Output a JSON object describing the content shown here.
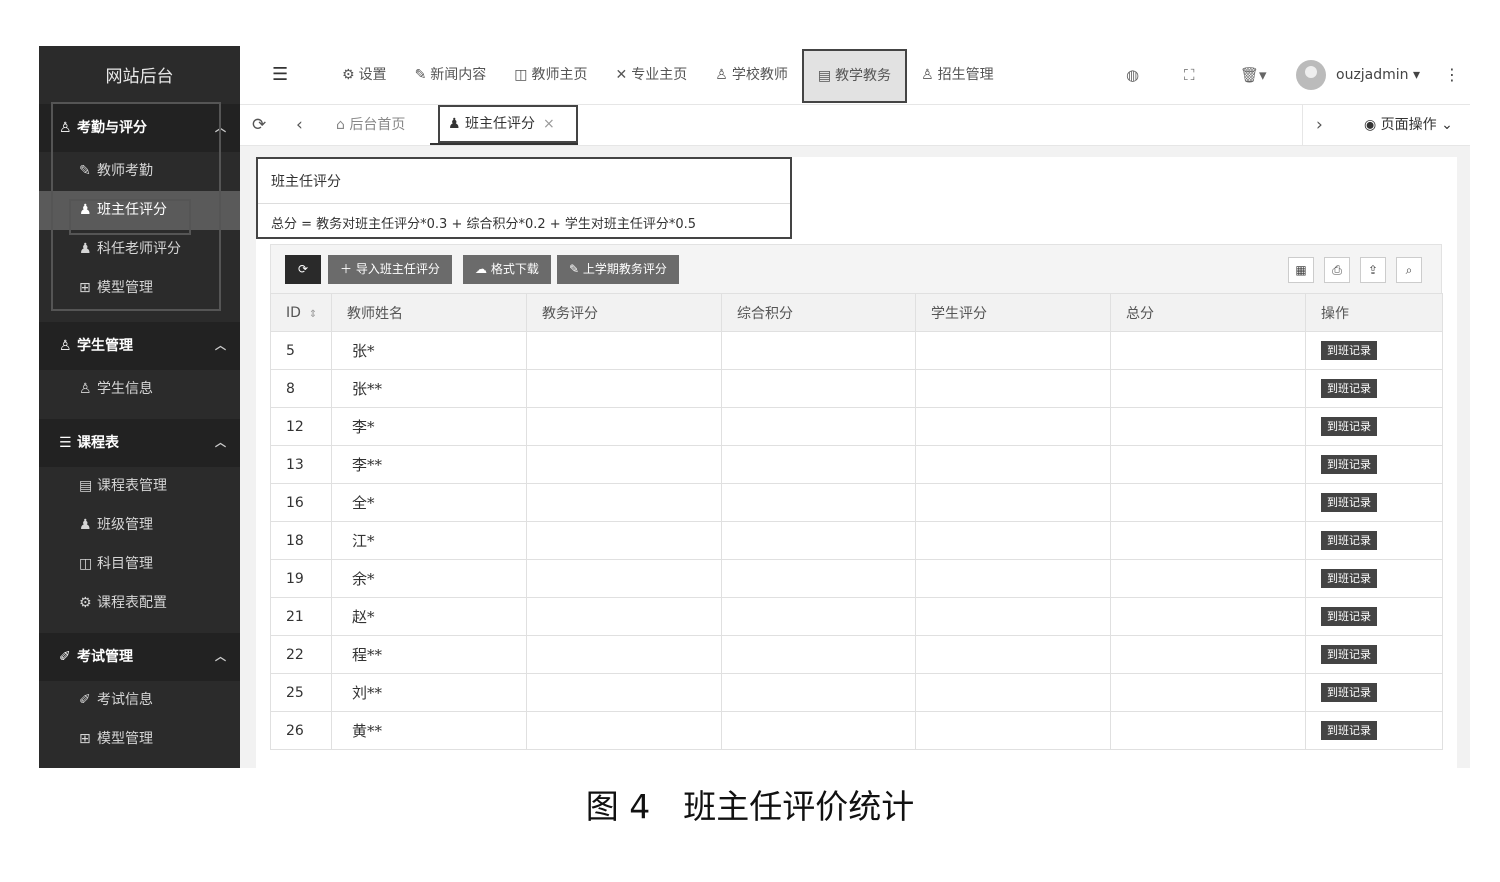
{
  "sidebar": {
    "logo": "网站后台",
    "groups": [
      {
        "label": "考勤与评分",
        "icon": "user-icon",
        "items": [
          {
            "label": "教师考勤",
            "icon": "edit-icon"
          },
          {
            "label": "班主任评分",
            "icon": "user-solid-icon"
          },
          {
            "label": "科任老师评分",
            "icon": "user-solid-icon"
          },
          {
            "label": "模型管理",
            "icon": "hierarchy-icon"
          }
        ]
      },
      {
        "label": "学生管理",
        "icon": "user-icon",
        "items": [
          {
            "label": "学生信息",
            "icon": "users-icon"
          }
        ]
      },
      {
        "label": "课程表",
        "icon": "list-icon",
        "items": [
          {
            "label": "课程表管理",
            "icon": "table-icon"
          },
          {
            "label": "班级管理",
            "icon": "user-solid-icon"
          },
          {
            "label": "科目管理",
            "icon": "book-icon"
          },
          {
            "label": "课程表配置",
            "icon": "gear-icon"
          }
        ]
      },
      {
        "label": "考试管理",
        "icon": "pen-icon",
        "items": [
          {
            "label": "考试信息",
            "icon": "pen-icon"
          },
          {
            "label": "模型管理",
            "icon": "hierarchy-icon"
          }
        ]
      }
    ]
  },
  "header": {
    "nav": [
      {
        "label": "设置",
        "icon": "gear-icon"
      },
      {
        "label": "新闻内容",
        "icon": "edit-icon"
      },
      {
        "label": "教师主页",
        "icon": "book-icon"
      },
      {
        "label": "专业主页",
        "icon": "tools-icon"
      },
      {
        "label": "学校教师",
        "icon": "user-icon"
      },
      {
        "label": "教学教务",
        "icon": "document-icon"
      },
      {
        "label": "招生管理",
        "icon": "users-icon"
      }
    ],
    "username": "ouzjadmin"
  },
  "tabs": {
    "home": "后台首页",
    "active": "班主任评分",
    "page_ops": "页面操作"
  },
  "card": {
    "title": "班主任评分",
    "formula": "总分 = 教务对班主任评分*0.3 + 综合积分*0.2 + 学生对班主任评分*0.5"
  },
  "toolbar": {
    "import_label": "导入班主任评分",
    "download_label": "格式下载",
    "last_term_label": "上学期教务评分"
  },
  "table": {
    "columns": [
      "ID",
      "教师姓名",
      "教务评分",
      "综合积分",
      "学生评分",
      "总分",
      "操作"
    ],
    "action_label": "到班记录",
    "rows": [
      {
        "id": "5",
        "name": "张*"
      },
      {
        "id": "8",
        "name": "张**"
      },
      {
        "id": "12",
        "name": "李*"
      },
      {
        "id": "13",
        "name": "李**"
      },
      {
        "id": "16",
        "name": "全*"
      },
      {
        "id": "18",
        "name": "江*"
      },
      {
        "id": "19",
        "name": "余*"
      },
      {
        "id": "21",
        "name": "赵*"
      },
      {
        "id": "22",
        "name": "程**"
      },
      {
        "id": "25",
        "name": "刘**"
      },
      {
        "id": "26",
        "name": "黄**"
      }
    ]
  },
  "caption": "图 4　班主任评价统计"
}
